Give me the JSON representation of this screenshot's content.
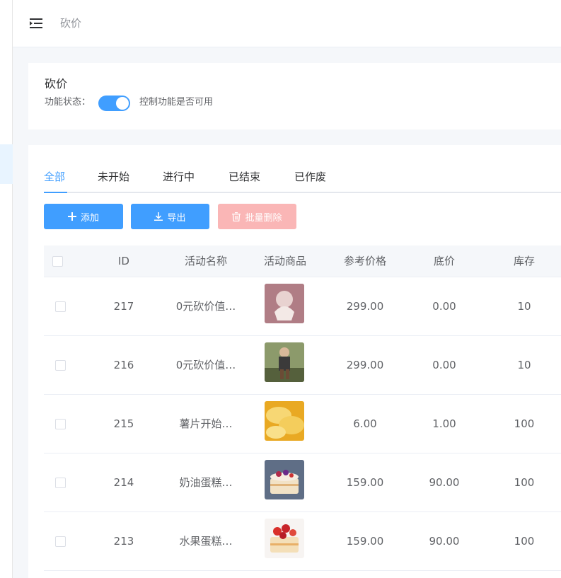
{
  "header": {
    "title": "砍价",
    "menu_icon": "indent-icon"
  },
  "settings": {
    "heading": "砍价",
    "status_label": "功能状态：",
    "switch_on": true,
    "switch_desc": "控制功能是否可用"
  },
  "tabs": [
    {
      "label": "全部",
      "active": true
    },
    {
      "label": "未开始",
      "active": false
    },
    {
      "label": "进行中",
      "active": false
    },
    {
      "label": "已结束",
      "active": false
    },
    {
      "label": "已作废",
      "active": false
    }
  ],
  "toolbar": {
    "add_label": "添加",
    "export_label": "导出",
    "batch_delete_label": "批量删除"
  },
  "table": {
    "columns": [
      "ID",
      "活动名称",
      "活动商品",
      "参考价格",
      "底价",
      "库存"
    ],
    "rows": [
      {
        "id": "217",
        "name": "0元砍价值…",
        "price": "299.00",
        "floor": "0.00",
        "stock": "10",
        "image": "scarf-product-image",
        "color": "#c99aa0"
      },
      {
        "id": "216",
        "name": "0元砍价值…",
        "price": "299.00",
        "floor": "0.00",
        "stock": "10",
        "image": "outfit-product-image",
        "color": "#6d7b4e"
      },
      {
        "id": "215",
        "name": "薯片开始…",
        "price": "6.00",
        "floor": "1.00",
        "stock": "100",
        "image": "chips-product-image",
        "color": "#f0c040"
      },
      {
        "id": "214",
        "name": "奶油蛋糕…",
        "price": "159.00",
        "floor": "90.00",
        "stock": "100",
        "image": "cream-cake-product-image",
        "color": "#6e7f9a"
      },
      {
        "id": "213",
        "name": "水果蛋糕…",
        "price": "159.00",
        "floor": "90.00",
        "stock": "100",
        "image": "fruit-cake-product-image",
        "color": "#d9423b"
      }
    ]
  },
  "colors": {
    "primary": "#409eff",
    "danger_disabled": "#fab6b6"
  }
}
